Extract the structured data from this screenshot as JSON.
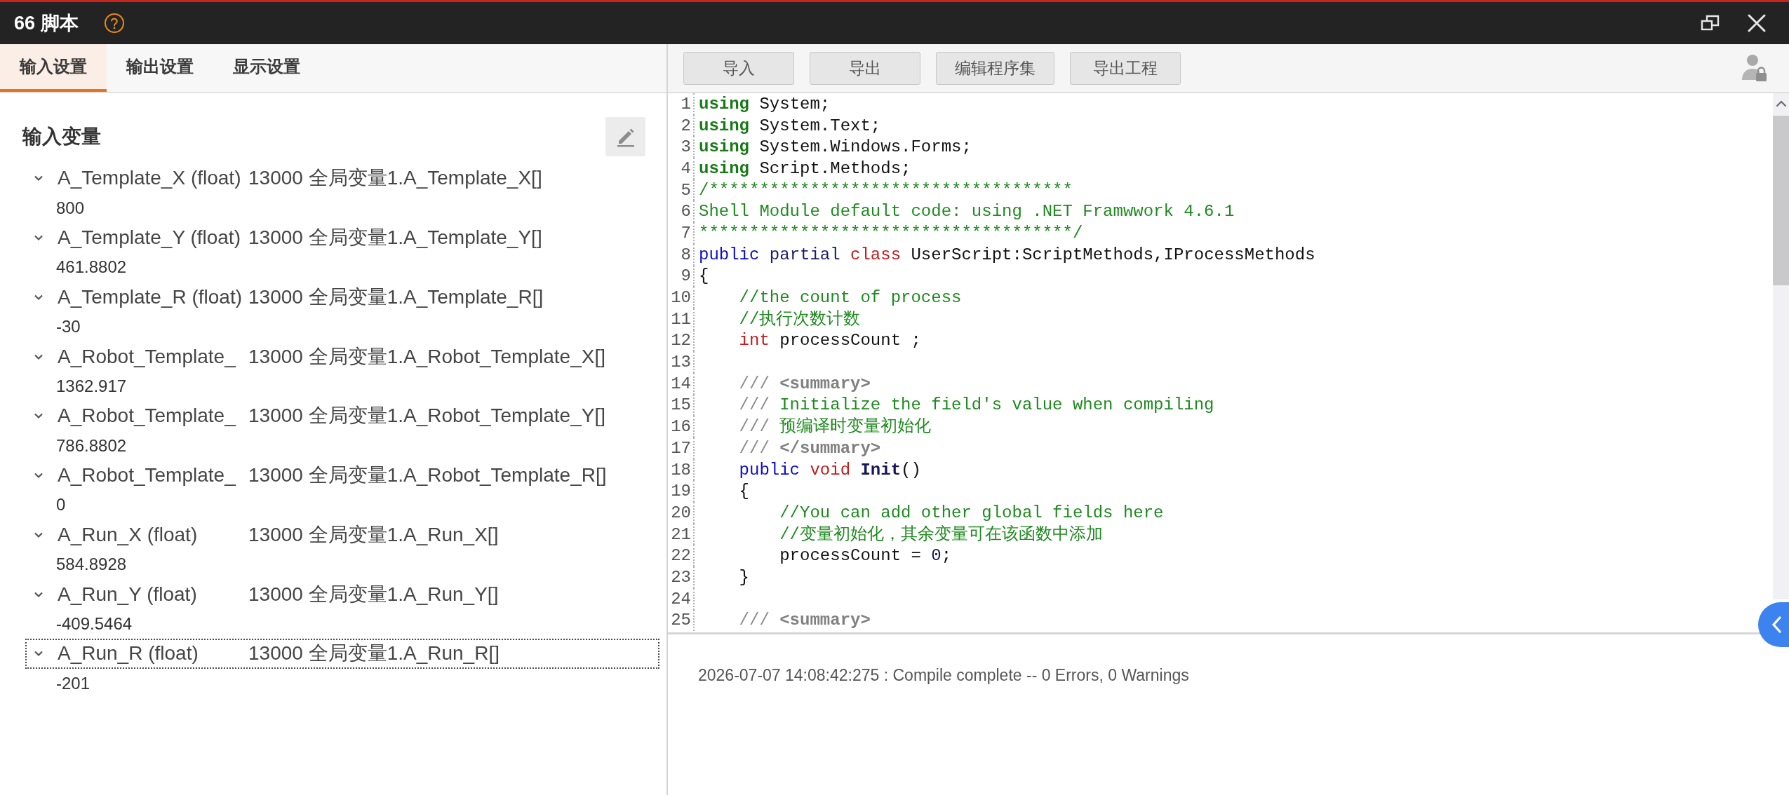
{
  "window": {
    "title": "66 脚本"
  },
  "left_panel": {
    "tabs": [
      {
        "label": "输入设置",
        "selected": true
      },
      {
        "label": "输出设置",
        "selected": false
      },
      {
        "label": "显示设置",
        "selected": false
      }
    ],
    "section_title": "输入变量",
    "variables": [
      {
        "name": "A_Template_X (float)",
        "binding": "13000 全局变量1.A_Template_X[]",
        "value": "800",
        "expanded": true,
        "selected": false
      },
      {
        "name": "A_Template_Y (float)",
        "binding": "13000 全局变量1.A_Template_Y[]",
        "value": "461.8802",
        "expanded": true,
        "selected": false
      },
      {
        "name": "A_Template_R (float)",
        "binding": "13000 全局变量1.A_Template_R[]",
        "value": "-30",
        "expanded": true,
        "selected": false
      },
      {
        "name": "A_Robot_Template_",
        "binding": "13000 全局变量1.A_Robot_Template_X[]",
        "value": "1362.917",
        "expanded": true,
        "selected": false
      },
      {
        "name": "A_Robot_Template_",
        "binding": "13000 全局变量1.A_Robot_Template_Y[]",
        "value": "786.8802",
        "expanded": true,
        "selected": false
      },
      {
        "name": "A_Robot_Template_",
        "binding": "13000 全局变量1.A_Robot_Template_R[]",
        "value": "0",
        "expanded": true,
        "selected": false
      },
      {
        "name": "A_Run_X (float)",
        "binding": "13000 全局变量1.A_Run_X[]",
        "value": "584.8928",
        "expanded": true,
        "selected": false
      },
      {
        "name": "A_Run_Y (float)",
        "binding": "13000 全局变量1.A_Run_Y[]",
        "value": "-409.5464",
        "expanded": true,
        "selected": false
      },
      {
        "name": "A_Run_R (float)",
        "binding": "13000 全局变量1.A_Run_R[]",
        "value": "-201",
        "expanded": true,
        "selected": true
      }
    ]
  },
  "toolbar": {
    "buttons": [
      "导入",
      "导出",
      "编辑程序集",
      "导出工程"
    ]
  },
  "editor": {
    "lines": [
      {
        "number": "1",
        "tokens": [
          {
            "text": "using",
            "kind": "directive"
          },
          {
            "text": " System;",
            "kind": "plain"
          }
        ]
      },
      {
        "number": "2",
        "tokens": [
          {
            "text": "using",
            "kind": "directive"
          },
          {
            "text": " System.Text;",
            "kind": "plain"
          }
        ]
      },
      {
        "number": "3",
        "tokens": [
          {
            "text": "using",
            "kind": "directive"
          },
          {
            "text": " System.Windows.Forms;",
            "kind": "plain"
          }
        ]
      },
      {
        "number": "4",
        "tokens": [
          {
            "text": "using",
            "kind": "directive"
          },
          {
            "text": " Script.Methods;",
            "kind": "plain"
          }
        ]
      },
      {
        "number": "5",
        "tokens": [
          {
            "text": "/************************************",
            "kind": "comment"
          }
        ]
      },
      {
        "number": "6",
        "tokens": [
          {
            "text": "Shell Module default code: using .NET Framwwork 4.6.1",
            "kind": "comment"
          }
        ]
      },
      {
        "number": "7",
        "tokens": [
          {
            "text": "*************************************/",
            "kind": "comment"
          }
        ]
      },
      {
        "number": "8",
        "tokens": [
          {
            "text": "public",
            "kind": "keyword"
          },
          {
            "text": " partial",
            "kind": "modifier"
          },
          {
            "text": " class",
            "kind": "type"
          },
          {
            "text": " UserScript:ScriptMethods,IProcessMethods",
            "kind": "plain"
          }
        ]
      },
      {
        "number": "9",
        "tokens": [
          {
            "text": "{",
            "kind": "plain"
          }
        ]
      },
      {
        "number": "10",
        "tokens": [
          {
            "text": "    //the count of process",
            "kind": "comment"
          }
        ]
      },
      {
        "number": "11",
        "tokens": [
          {
            "text": "    //执行次数计数",
            "kind": "comment"
          }
        ]
      },
      {
        "number": "12",
        "tokens": [
          {
            "text": "    int",
            "kind": "type"
          },
          {
            "text": " processCount ;",
            "kind": "plain"
          }
        ]
      },
      {
        "number": "13"
      },
      {
        "number": "14",
        "tokens": [
          {
            "text": "    /// ",
            "kind": "doc"
          },
          {
            "text": "<summary>",
            "kind": "doc_tag"
          }
        ]
      },
      {
        "number": "15",
        "tokens": [
          {
            "text": "    /// ",
            "kind": "doc"
          },
          {
            "text": "Initialize the field's value when compiling",
            "kind": "comment"
          }
        ]
      },
      {
        "number": "16",
        "tokens": [
          {
            "text": "    /// ",
            "kind": "doc"
          },
          {
            "text": "预编译时变量初始化",
            "kind": "comment"
          }
        ]
      },
      {
        "number": "17",
        "tokens": [
          {
            "text": "    /// ",
            "kind": "doc"
          },
          {
            "text": "</summary>",
            "kind": "doc_tag"
          }
        ]
      },
      {
        "number": "18",
        "tokens": [
          {
            "text": "    public",
            "kind": "keyword"
          },
          {
            "text": " void",
            "kind": "type"
          },
          {
            "text": " Init",
            "kind": "method"
          },
          {
            "text": "()",
            "kind": "plain"
          }
        ]
      },
      {
        "number": "19",
        "tokens": [
          {
            "text": "    {",
            "kind": "plain"
          }
        ]
      },
      {
        "number": "20",
        "tokens": [
          {
            "text": "        //You can add other global fields here",
            "kind": "comment"
          }
        ]
      },
      {
        "number": "21",
        "tokens": [
          {
            "text": "        //变量初始化，其余变量可在该函数中添加",
            "kind": "comment"
          }
        ]
      },
      {
        "number": "22",
        "tokens": [
          {
            "text": "        processCount = ",
            "kind": "plain"
          },
          {
            "text": "0",
            "kind": "number"
          },
          {
            "text": ";",
            "kind": "plain"
          }
        ]
      },
      {
        "number": "23",
        "tokens": [
          {
            "text": "    }",
            "kind": "plain"
          }
        ]
      },
      {
        "number": "24"
      },
      {
        "number": "25",
        "tokens": [
          {
            "text": "    /// ",
            "kind": "doc"
          },
          {
            "text": "<summary>",
            "kind": "doc_tag"
          }
        ]
      }
    ]
  },
  "log": {
    "messages": [
      "2026-07-07 14:08:42:275 : Compile complete -- 0 Errors, 0 Warnings"
    ]
  }
}
